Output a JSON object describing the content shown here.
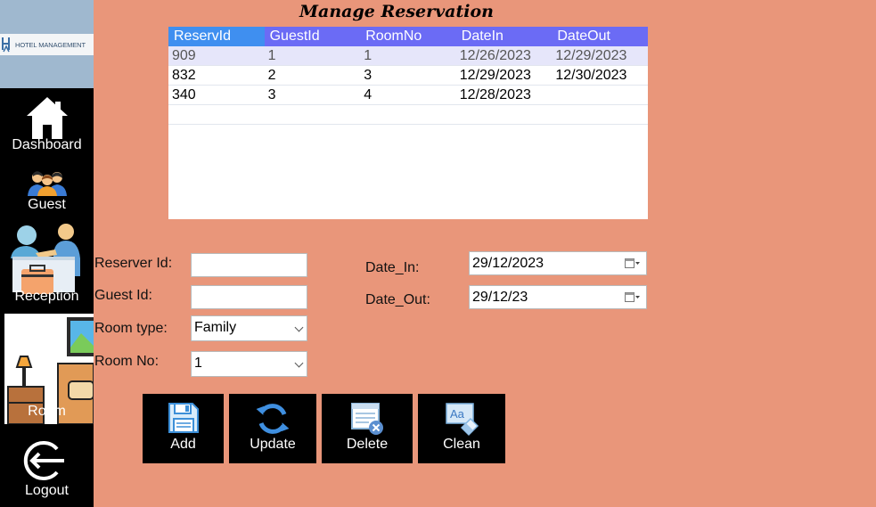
{
  "logo": {
    "mark": "H",
    "text": "HOTEL MANAGEMENT"
  },
  "sidebar": {
    "items": [
      {
        "label": "Dashboard"
      },
      {
        "label": "Guest"
      },
      {
        "label": "Reception"
      },
      {
        "label": "Room"
      },
      {
        "label": "Logout"
      }
    ]
  },
  "page": {
    "title": "Manage Reservation"
  },
  "grid": {
    "columns": [
      "ReservId",
      "GuestId",
      "RoomNo",
      "DateIn",
      "DateOut"
    ],
    "rows": [
      [
        "909",
        "1",
        "1",
        "12/26/2023",
        "12/29/2023"
      ],
      [
        "832",
        "2",
        "3",
        "12/29/2023",
        "12/30/2023"
      ],
      [
        "340",
        "3",
        "4",
        "12/28/2023",
        ""
      ]
    ]
  },
  "form": {
    "reserver_id": {
      "label": "Reserver Id:",
      "value": ""
    },
    "guest_id": {
      "label": "Guest Id:",
      "value": ""
    },
    "room_type": {
      "label": "Room type:",
      "value": "Family"
    },
    "room_no": {
      "label": "Room No:",
      "value": "1"
    },
    "date_in": {
      "label": "Date_In:",
      "value": "29/12/2023"
    },
    "date_out": {
      "label": "Date_Out:",
      "value": "29/12/23"
    }
  },
  "buttons": {
    "add": "Add",
    "update": "Update",
    "delete": "Delete",
    "clean": "Clean"
  },
  "colors": {
    "background": "#E9967A",
    "sidebar": "#000000",
    "grid_header": "#6B6BF5",
    "grid_header_first": "#3F8FF0",
    "selected_row": "#E6E6FA"
  }
}
